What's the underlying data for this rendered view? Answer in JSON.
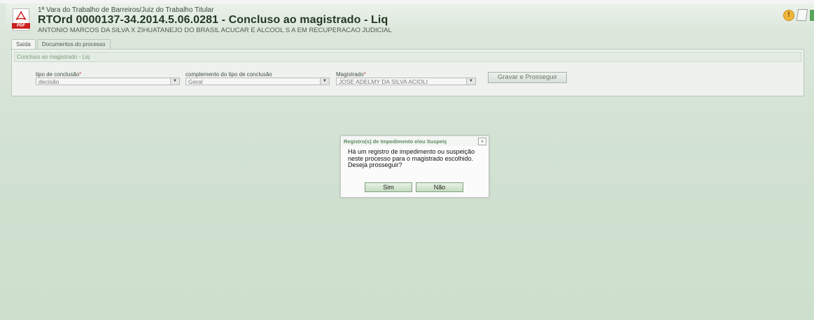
{
  "header": {
    "court_line": "1ª Vara do Trabalho de Barreiros/Juiz do Trabalho Titular",
    "title": "RTOrd 0000137-34.2014.5.06.0281 - Concluso ao magistrado - Liq",
    "parties": "ANTONIO MARCOS DA SILVA X ZIHUATANEJO DO BRASIL ACUCAR E ALCOOL S A EM RECUPERACAO JUDICIAL",
    "pdf_tag": "PDF"
  },
  "tabs": [
    {
      "label": "Saída"
    },
    {
      "label": "Documentos do processo"
    }
  ],
  "panel": {
    "heading": "Concluso ao magistrado - Liq",
    "fields": {
      "tipo": {
        "label": "tipo de conclusão",
        "value": "decisão"
      },
      "complemento": {
        "label": "complemento do tipo de conclusão",
        "value": "Geral"
      },
      "magistrado": {
        "label": "Magistrado",
        "value": "JOSE ADELMY DA SILVA ACIOLI"
      }
    },
    "save_button": "Gravar e Prosseguir"
  },
  "dialog": {
    "title": "Registro(s) de Impedimento e/ou Suspeiç",
    "message": "Há um registro de impedimento ou suspeição neste processo para o magistrado escolhido. Deseja prosseguir?",
    "yes": "Sim",
    "no": "Não"
  },
  "colors": {
    "accent": "#5f8a5f",
    "background": "#d3e2d3",
    "title": "#243824",
    "required": "#d04040"
  },
  "icons": [
    "pdf-icon",
    "warning-icon",
    "document-icon",
    "close-icon",
    "dropdown-arrow-icon"
  ]
}
